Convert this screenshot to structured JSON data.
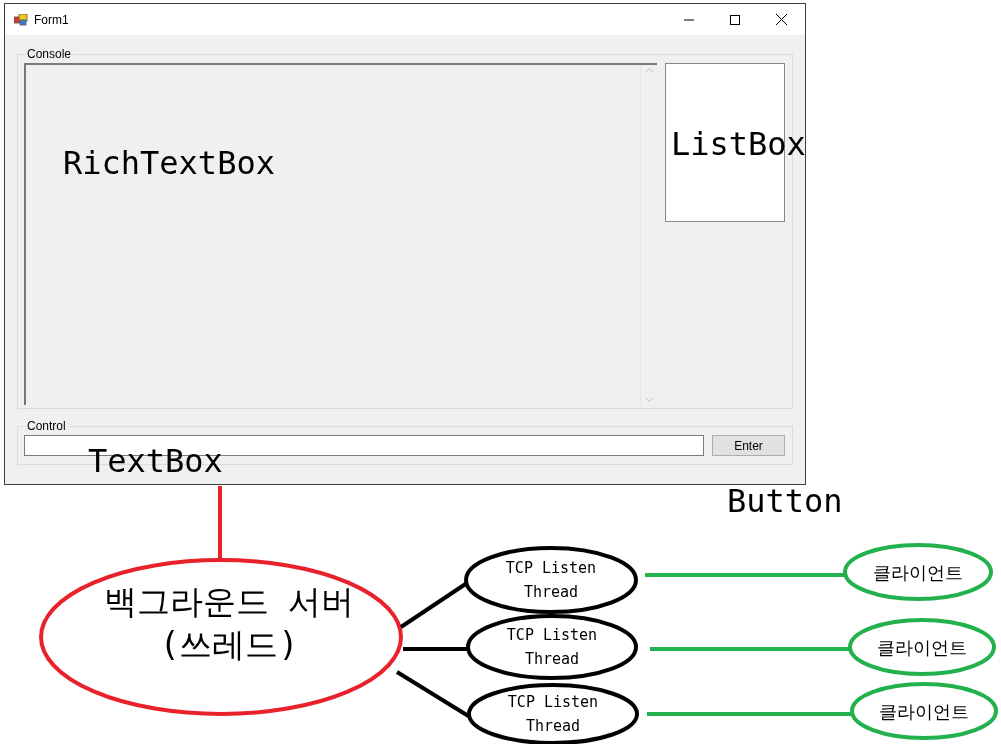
{
  "window": {
    "title": "Form1"
  },
  "console_group": {
    "label": "Console"
  },
  "control_group": {
    "label": "Control",
    "button": "Enter"
  },
  "annotations": [
    {
      "kind": "richtextbox",
      "text": "RichTextBox"
    },
    {
      "kind": "listbox",
      "text": "ListBox"
    },
    {
      "kind": "textbox",
      "text": "TextBox"
    },
    {
      "kind": "button",
      "text": "Button"
    }
  ],
  "diagram": {
    "server": {
      "lines": [
        "백그라운드 서버",
        "(쓰레드)"
      ]
    },
    "threads": [
      {
        "lines": [
          "TCP Listen",
          "Thread"
        ],
        "client": "클라이언트"
      },
      {
        "lines": [
          "TCP Listen",
          "Thread"
        ],
        "client": "클라이언트"
      },
      {
        "lines": [
          "TCP Listen",
          "Thread"
        ],
        "client": "클라이언트"
      }
    ]
  }
}
